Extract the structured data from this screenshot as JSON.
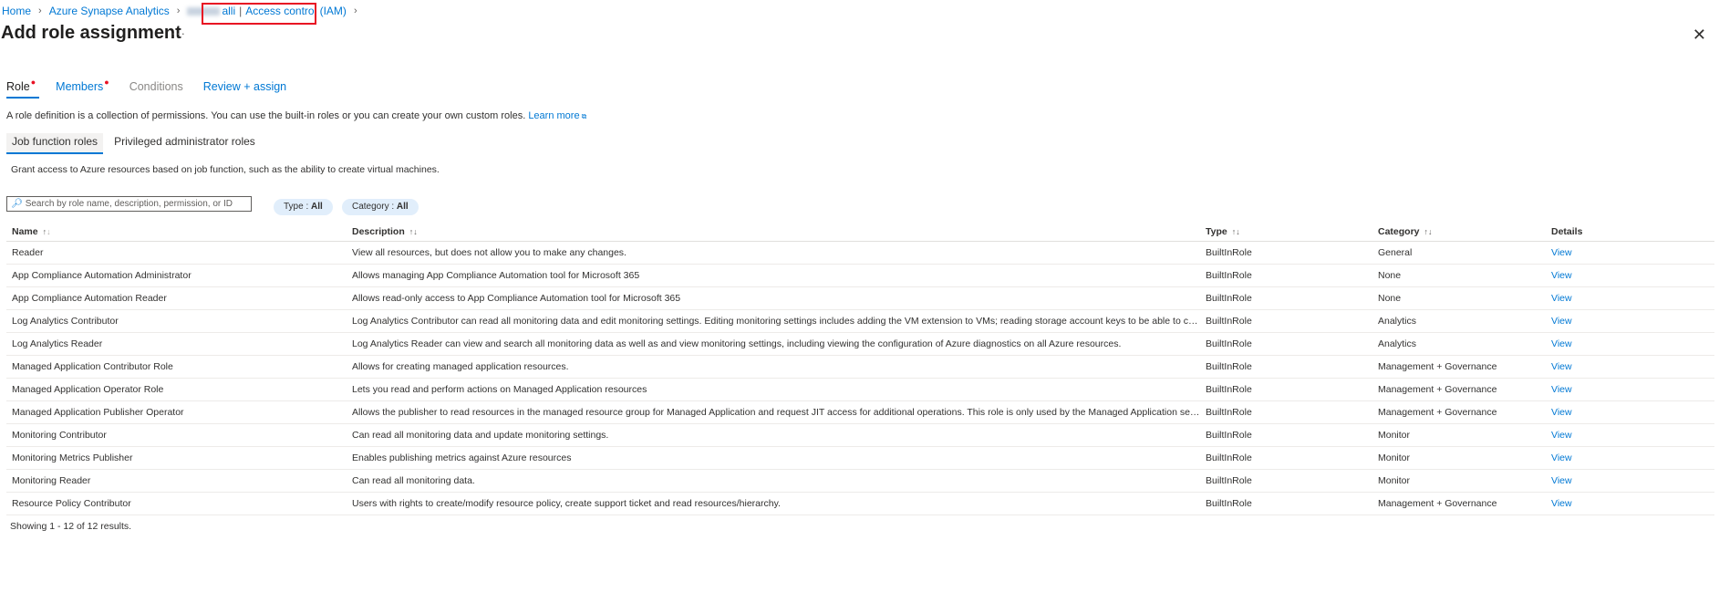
{
  "breadcrumb": {
    "home": "Home",
    "service": "Azure Synapse Analytics",
    "resource_suffix": "alli",
    "page": "Access control (IAM)"
  },
  "title": "Add role assignment",
  "more": "···",
  "close": "✕",
  "tabs": [
    {
      "label": "Role",
      "required": true,
      "state": "active"
    },
    {
      "label": "Members",
      "required": true,
      "state": "link"
    },
    {
      "label": "Conditions",
      "required": false,
      "state": "disabled"
    },
    {
      "label": "Review + assign",
      "required": false,
      "state": "link"
    }
  ],
  "description": "A role definition is a collection of permissions. You can use the built-in roles or you can create your own custom roles.",
  "learn_more": "Learn more",
  "subtabs": [
    "Job function roles",
    "Privileged administrator roles"
  ],
  "grant_text": "Grant access to Azure resources based on job function, such as the ability to create virtual machines.",
  "search": {
    "placeholder": "Search by role name, description, permission, or ID",
    "value": ""
  },
  "filters": {
    "type": {
      "label": "Type : ",
      "value": "All"
    },
    "category": {
      "label": "Category : ",
      "value": "All"
    }
  },
  "table": {
    "columns": [
      "Name",
      "Description",
      "Type",
      "Category",
      "Details"
    ],
    "rows": [
      {
        "name": "Reader",
        "description": "View all resources, but does not allow you to make any changes.",
        "type": "BuiltInRole",
        "category": "General",
        "details": "View"
      },
      {
        "name": "App Compliance Automation Administrator",
        "description": "Allows managing App Compliance Automation tool for Microsoft 365",
        "type": "BuiltInRole",
        "category": "None",
        "details": "View"
      },
      {
        "name": "App Compliance Automation Reader",
        "description": "Allows read-only access to App Compliance Automation tool for Microsoft 365",
        "type": "BuiltInRole",
        "category": "None",
        "details": "View"
      },
      {
        "name": "Log Analytics Contributor",
        "description": "Log Analytics Contributor can read all monitoring data and edit monitoring settings. Editing monitoring settings includes adding the VM extension to VMs; reading storage account keys to be able to configure col...",
        "type": "BuiltInRole",
        "category": "Analytics",
        "details": "View"
      },
      {
        "name": "Log Analytics Reader",
        "description": "Log Analytics Reader can view and search all monitoring data as well as and view monitoring settings, including viewing the configuration of Azure diagnostics on all Azure resources.",
        "type": "BuiltInRole",
        "category": "Analytics",
        "details": "View"
      },
      {
        "name": "Managed Application Contributor Role",
        "description": "Allows for creating managed application resources.",
        "type": "BuiltInRole",
        "category": "Management + Governance",
        "details": "View"
      },
      {
        "name": "Managed Application Operator Role",
        "description": "Lets you read and perform actions on Managed Application resources",
        "type": "BuiltInRole",
        "category": "Management + Governance",
        "details": "View"
      },
      {
        "name": "Managed Application Publisher Operator",
        "description": "Allows the publisher to read resources in the managed resource group for Managed Application and request JIT access for additional operations. This role is only used by the Managed Application service to provi...",
        "type": "BuiltInRole",
        "category": "Management + Governance",
        "details": "View"
      },
      {
        "name": "Monitoring Contributor",
        "description": "Can read all monitoring data and update monitoring settings.",
        "type": "BuiltInRole",
        "category": "Monitor",
        "details": "View"
      },
      {
        "name": "Monitoring Metrics Publisher",
        "description": "Enables publishing metrics against Azure resources",
        "type": "BuiltInRole",
        "category": "Monitor",
        "details": "View"
      },
      {
        "name": "Monitoring Reader",
        "description": "Can read all monitoring data.",
        "type": "BuiltInRole",
        "category": "Monitor",
        "details": "View"
      },
      {
        "name": "Resource Policy Contributor",
        "description": "Users with rights to create/modify resource policy, create support ticket and read resources/hierarchy.",
        "type": "BuiltInRole",
        "category": "Management + Governance",
        "details": "View"
      }
    ]
  },
  "footer": "Showing 1 - 12 of 12 results.",
  "colors": {
    "link": "#0078d4",
    "required": "#e81123",
    "highlight": "#e81123",
    "pill_bg": "#e1eefb"
  },
  "icons": [
    "chevron-right-icon",
    "more-icon",
    "close-icon",
    "external-link-icon",
    "search-icon",
    "sort-icon"
  ]
}
